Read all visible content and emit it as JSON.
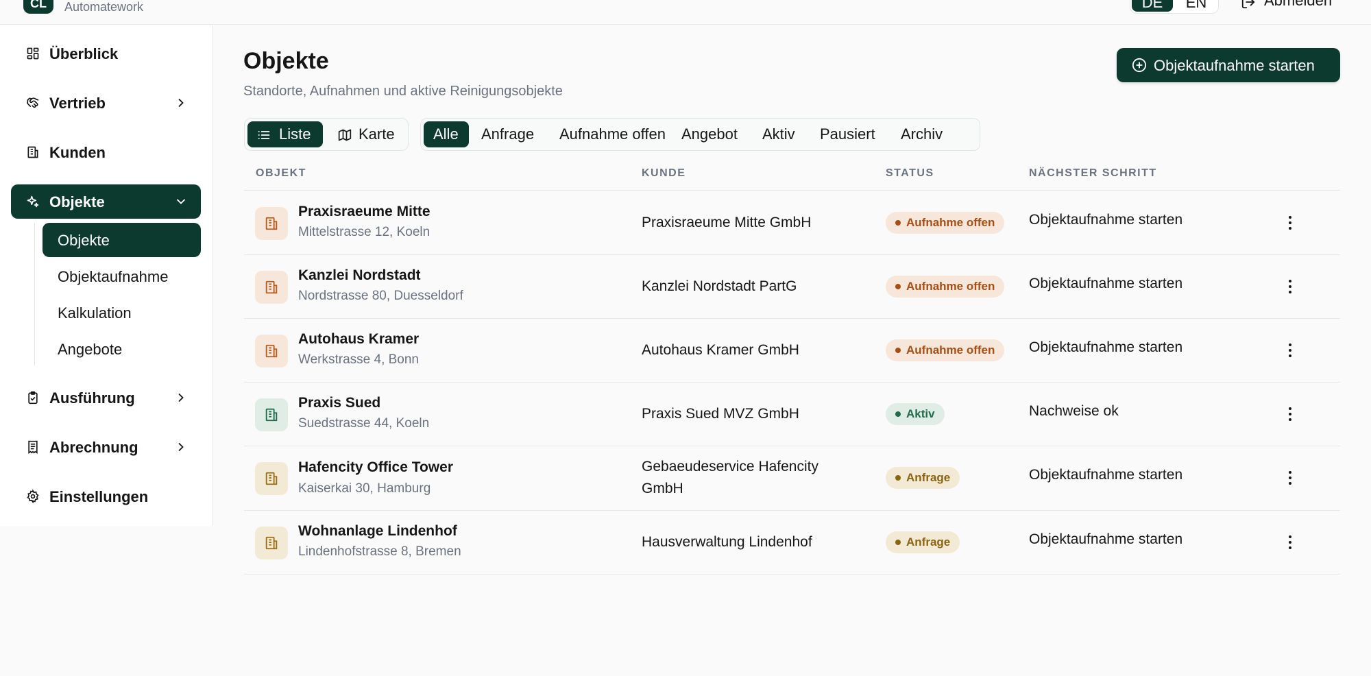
{
  "app": {
    "badge": "CL",
    "subtitle": "Automatework",
    "lang": [
      "DE",
      "EN"
    ],
    "logout": "Abmelden"
  },
  "sidebar": {
    "items": [
      {
        "label": "Überblick",
        "icon": "dashboard-icon"
      },
      {
        "label": "Vertrieb",
        "icon": "handshake-icon"
      },
      {
        "label": "Kunden",
        "icon": "building-icon"
      },
      {
        "label": "Objekte",
        "icon": "sparkles-icon"
      },
      {
        "label": "Ausführung",
        "icon": "clipboard-icon"
      },
      {
        "label": "Abrechnung",
        "icon": "receipt-icon"
      },
      {
        "label": "Einstellungen",
        "icon": "gear-icon"
      }
    ],
    "sub_items": [
      "Objekte",
      "Objektaufnahme",
      "Kalkulation",
      "Angebote"
    ]
  },
  "page": {
    "title": "Objekte",
    "subtitle": "Standorte, Aufnahmen und aktive Reinigungsobjekte",
    "primary_button": "Objektaufnahme starten"
  },
  "view_toggle": [
    "Liste",
    "Karte"
  ],
  "filters": [
    "Alle",
    "Anfrage",
    "Aufnahme offen",
    "Angebot",
    "Aktiv",
    "Pausiert",
    "Archiv"
  ],
  "table": {
    "headers": [
      "OBJEKT",
      "KUNDE",
      "STATUS",
      "NÄCHSTER SCHRITT"
    ],
    "rows": [
      {
        "name": "Praxisraeume Mitte",
        "address": "Mittelstrasse 12, Koeln",
        "customer": "Praxisraeume Mitte GmbH",
        "status": "Aufnahme offen",
        "next": "Objektaufnahme starten"
      },
      {
        "name": "Kanzlei Nordstadt",
        "address": "Nordstrasse 80, Duesseldorf",
        "customer": "Kanzlei Nordstadt PartG",
        "status": "Aufnahme offen",
        "next": "Objektaufnahme starten"
      },
      {
        "name": "Autohaus Kramer",
        "address": "Werkstrasse 4, Bonn",
        "customer": "Autohaus Kramer GmbH",
        "status": "Aufnahme offen",
        "next": "Objektaufnahme starten"
      },
      {
        "name": "Praxis Sued",
        "address": "Suedstrasse 44, Koeln",
        "customer": "Praxis Sued MVZ GmbH",
        "status": "Aktiv",
        "next": "Nachweise ok"
      },
      {
        "name": "Hafencity Office Tower",
        "address": "Kaiserkai 30, Hamburg",
        "customer": "Gebaeudeservice Hafencity GmbH",
        "status": "Anfrage",
        "next": "Objektaufnahme starten"
      },
      {
        "name": "Wohnanlage Lindenhof",
        "address": "Lindenhofstrasse 8, Bremen",
        "customer": "Hausverwaltung Lindenhof",
        "status": "Anfrage",
        "next": "Objektaufnahme starten"
      }
    ]
  },
  "colors": {
    "brand": "#0d3a2f",
    "status_open_bg": "#f7e7da",
    "status_open_fg": "#a84e14",
    "status_active_bg": "#dfede6",
    "status_active_fg": "#1f6b4a",
    "status_request_bg": "#f3ead6",
    "status_request_fg": "#8a6411"
  }
}
